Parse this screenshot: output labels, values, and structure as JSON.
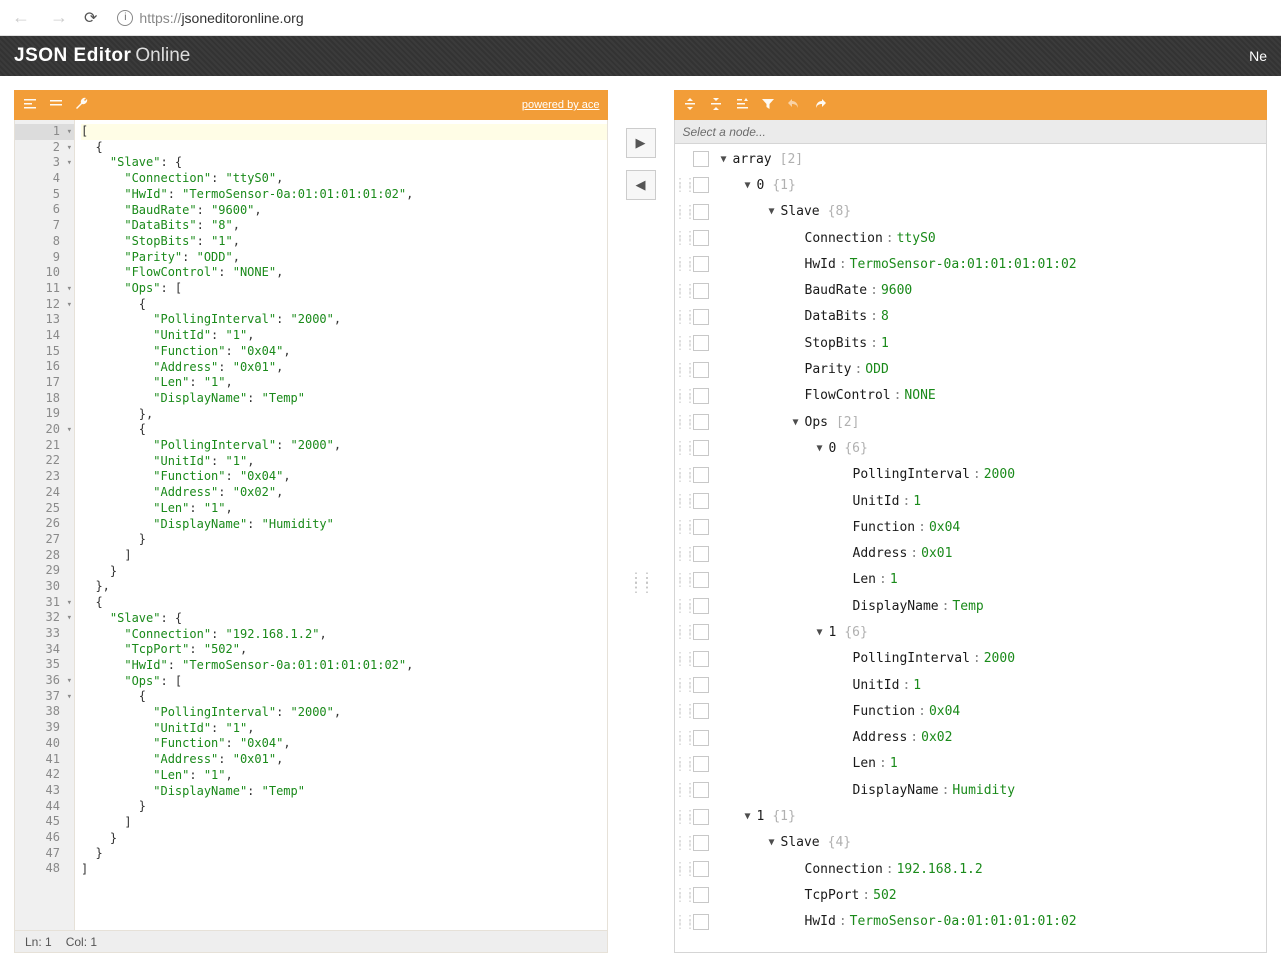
{
  "browser": {
    "url_proto": "https://",
    "url_host": "jsoneditoronline.org"
  },
  "header": {
    "title_strong": "JSON Editor",
    "title_light": "Online",
    "right_cut": "Ne"
  },
  "left_toolbar": {
    "powered": "powered by ace"
  },
  "status": {
    "ln": "Ln: 1",
    "col": "Col: 1"
  },
  "node_path_placeholder": "Select a node...",
  "code_lines": [
    {
      "n": 1,
      "fold": "▾",
      "hl": true,
      "text": "[",
      "parts": [
        {
          "t": "[",
          "c": "pun"
        }
      ]
    },
    {
      "n": 2,
      "fold": "▾",
      "text": "  {",
      "parts": [
        {
          "t": "  {",
          "c": "pun"
        }
      ]
    },
    {
      "n": 3,
      "fold": "▾",
      "parts": [
        {
          "t": "    ",
          "c": "pun"
        },
        {
          "t": "\"Slave\"",
          "c": "str"
        },
        {
          "t": ": {",
          "c": "pun"
        }
      ]
    },
    {
      "n": 4,
      "parts": [
        {
          "t": "      ",
          "c": "pun"
        },
        {
          "t": "\"Connection\"",
          "c": "str"
        },
        {
          "t": ": ",
          "c": "pun"
        },
        {
          "t": "\"ttyS0\"",
          "c": "str"
        },
        {
          "t": ",",
          "c": "pun"
        }
      ]
    },
    {
      "n": 5,
      "parts": [
        {
          "t": "      ",
          "c": "pun"
        },
        {
          "t": "\"HwId\"",
          "c": "str"
        },
        {
          "t": ": ",
          "c": "pun"
        },
        {
          "t": "\"TermoSensor-0a:01:01:01:01:02\"",
          "c": "str"
        },
        {
          "t": ",",
          "c": "pun"
        }
      ]
    },
    {
      "n": 6,
      "parts": [
        {
          "t": "      ",
          "c": "pun"
        },
        {
          "t": "\"BaudRate\"",
          "c": "str"
        },
        {
          "t": ": ",
          "c": "pun"
        },
        {
          "t": "\"9600\"",
          "c": "str"
        },
        {
          "t": ",",
          "c": "pun"
        }
      ]
    },
    {
      "n": 7,
      "parts": [
        {
          "t": "      ",
          "c": "pun"
        },
        {
          "t": "\"DataBits\"",
          "c": "str"
        },
        {
          "t": ": ",
          "c": "pun"
        },
        {
          "t": "\"8\"",
          "c": "str"
        },
        {
          "t": ",",
          "c": "pun"
        }
      ]
    },
    {
      "n": 8,
      "parts": [
        {
          "t": "      ",
          "c": "pun"
        },
        {
          "t": "\"StopBits\"",
          "c": "str"
        },
        {
          "t": ": ",
          "c": "pun"
        },
        {
          "t": "\"1\"",
          "c": "str"
        },
        {
          "t": ",",
          "c": "pun"
        }
      ]
    },
    {
      "n": 9,
      "parts": [
        {
          "t": "      ",
          "c": "pun"
        },
        {
          "t": "\"Parity\"",
          "c": "str"
        },
        {
          "t": ": ",
          "c": "pun"
        },
        {
          "t": "\"ODD\"",
          "c": "str"
        },
        {
          "t": ",",
          "c": "pun"
        }
      ]
    },
    {
      "n": 10,
      "parts": [
        {
          "t": "      ",
          "c": "pun"
        },
        {
          "t": "\"FlowControl\"",
          "c": "str"
        },
        {
          "t": ": ",
          "c": "pun"
        },
        {
          "t": "\"NONE\"",
          "c": "str"
        },
        {
          "t": ",",
          "c": "pun"
        }
      ]
    },
    {
      "n": 11,
      "fold": "▾",
      "parts": [
        {
          "t": "      ",
          "c": "pun"
        },
        {
          "t": "\"Ops\"",
          "c": "str"
        },
        {
          "t": ": [",
          "c": "pun"
        }
      ]
    },
    {
      "n": 12,
      "fold": "▾",
      "parts": [
        {
          "t": "        {",
          "c": "pun"
        }
      ]
    },
    {
      "n": 13,
      "parts": [
        {
          "t": "          ",
          "c": "pun"
        },
        {
          "t": "\"PollingInterval\"",
          "c": "str"
        },
        {
          "t": ": ",
          "c": "pun"
        },
        {
          "t": "\"2000\"",
          "c": "str"
        },
        {
          "t": ",",
          "c": "pun"
        }
      ]
    },
    {
      "n": 14,
      "parts": [
        {
          "t": "          ",
          "c": "pun"
        },
        {
          "t": "\"UnitId\"",
          "c": "str"
        },
        {
          "t": ": ",
          "c": "pun"
        },
        {
          "t": "\"1\"",
          "c": "str"
        },
        {
          "t": ",",
          "c": "pun"
        }
      ]
    },
    {
      "n": 15,
      "parts": [
        {
          "t": "          ",
          "c": "pun"
        },
        {
          "t": "\"Function\"",
          "c": "str"
        },
        {
          "t": ": ",
          "c": "pun"
        },
        {
          "t": "\"0x04\"",
          "c": "str"
        },
        {
          "t": ",",
          "c": "pun"
        }
      ]
    },
    {
      "n": 16,
      "parts": [
        {
          "t": "          ",
          "c": "pun"
        },
        {
          "t": "\"Address\"",
          "c": "str"
        },
        {
          "t": ": ",
          "c": "pun"
        },
        {
          "t": "\"0x01\"",
          "c": "str"
        },
        {
          "t": ",",
          "c": "pun"
        }
      ]
    },
    {
      "n": 17,
      "parts": [
        {
          "t": "          ",
          "c": "pun"
        },
        {
          "t": "\"Len\"",
          "c": "str"
        },
        {
          "t": ": ",
          "c": "pun"
        },
        {
          "t": "\"1\"",
          "c": "str"
        },
        {
          "t": ",",
          "c": "pun"
        }
      ]
    },
    {
      "n": 18,
      "parts": [
        {
          "t": "          ",
          "c": "pun"
        },
        {
          "t": "\"DisplayName\"",
          "c": "str"
        },
        {
          "t": ": ",
          "c": "pun"
        },
        {
          "t": "\"Temp\"",
          "c": "str"
        }
      ]
    },
    {
      "n": 19,
      "parts": [
        {
          "t": "        },",
          "c": "pun"
        }
      ]
    },
    {
      "n": 20,
      "fold": "▾",
      "parts": [
        {
          "t": "        {",
          "c": "pun"
        }
      ]
    },
    {
      "n": 21,
      "parts": [
        {
          "t": "          ",
          "c": "pun"
        },
        {
          "t": "\"PollingInterval\"",
          "c": "str"
        },
        {
          "t": ": ",
          "c": "pun"
        },
        {
          "t": "\"2000\"",
          "c": "str"
        },
        {
          "t": ",",
          "c": "pun"
        }
      ]
    },
    {
      "n": 22,
      "parts": [
        {
          "t": "          ",
          "c": "pun"
        },
        {
          "t": "\"UnitId\"",
          "c": "str"
        },
        {
          "t": ": ",
          "c": "pun"
        },
        {
          "t": "\"1\"",
          "c": "str"
        },
        {
          "t": ",",
          "c": "pun"
        }
      ]
    },
    {
      "n": 23,
      "parts": [
        {
          "t": "          ",
          "c": "pun"
        },
        {
          "t": "\"Function\"",
          "c": "str"
        },
        {
          "t": ": ",
          "c": "pun"
        },
        {
          "t": "\"0x04\"",
          "c": "str"
        },
        {
          "t": ",",
          "c": "pun"
        }
      ]
    },
    {
      "n": 24,
      "parts": [
        {
          "t": "          ",
          "c": "pun"
        },
        {
          "t": "\"Address\"",
          "c": "str"
        },
        {
          "t": ": ",
          "c": "pun"
        },
        {
          "t": "\"0x02\"",
          "c": "str"
        },
        {
          "t": ",",
          "c": "pun"
        }
      ]
    },
    {
      "n": 25,
      "parts": [
        {
          "t": "          ",
          "c": "pun"
        },
        {
          "t": "\"Len\"",
          "c": "str"
        },
        {
          "t": ": ",
          "c": "pun"
        },
        {
          "t": "\"1\"",
          "c": "str"
        },
        {
          "t": ",",
          "c": "pun"
        }
      ]
    },
    {
      "n": 26,
      "parts": [
        {
          "t": "          ",
          "c": "pun"
        },
        {
          "t": "\"DisplayName\"",
          "c": "str"
        },
        {
          "t": ": ",
          "c": "pun"
        },
        {
          "t": "\"Humidity\"",
          "c": "str"
        }
      ]
    },
    {
      "n": 27,
      "parts": [
        {
          "t": "        }",
          "c": "pun"
        }
      ]
    },
    {
      "n": 28,
      "parts": [
        {
          "t": "      ]",
          "c": "pun"
        }
      ]
    },
    {
      "n": 29,
      "parts": [
        {
          "t": "    }",
          "c": "pun"
        }
      ]
    },
    {
      "n": 30,
      "parts": [
        {
          "t": "  },",
          "c": "pun"
        }
      ]
    },
    {
      "n": 31,
      "fold": "▾",
      "parts": [
        {
          "t": "  {",
          "c": "pun"
        }
      ]
    },
    {
      "n": 32,
      "fold": "▾",
      "parts": [
        {
          "t": "    ",
          "c": "pun"
        },
        {
          "t": "\"Slave\"",
          "c": "str"
        },
        {
          "t": ": {",
          "c": "pun"
        }
      ]
    },
    {
      "n": 33,
      "parts": [
        {
          "t": "      ",
          "c": "pun"
        },
        {
          "t": "\"Connection\"",
          "c": "str"
        },
        {
          "t": ": ",
          "c": "pun"
        },
        {
          "t": "\"192.168.1.2\"",
          "c": "str"
        },
        {
          "t": ",",
          "c": "pun"
        }
      ]
    },
    {
      "n": 34,
      "parts": [
        {
          "t": "      ",
          "c": "pun"
        },
        {
          "t": "\"TcpPort\"",
          "c": "str"
        },
        {
          "t": ": ",
          "c": "pun"
        },
        {
          "t": "\"502\"",
          "c": "str"
        },
        {
          "t": ",",
          "c": "pun"
        }
      ]
    },
    {
      "n": 35,
      "parts": [
        {
          "t": "      ",
          "c": "pun"
        },
        {
          "t": "\"HwId\"",
          "c": "str"
        },
        {
          "t": ": ",
          "c": "pun"
        },
        {
          "t": "\"TermoSensor-0a:01:01:01:01:02\"",
          "c": "str"
        },
        {
          "t": ",",
          "c": "pun"
        }
      ]
    },
    {
      "n": 36,
      "fold": "▾",
      "parts": [
        {
          "t": "      ",
          "c": "pun"
        },
        {
          "t": "\"Ops\"",
          "c": "str"
        },
        {
          "t": ": [",
          "c": "pun"
        }
      ]
    },
    {
      "n": 37,
      "fold": "▾",
      "parts": [
        {
          "t": "        {",
          "c": "pun"
        }
      ]
    },
    {
      "n": 38,
      "parts": [
        {
          "t": "          ",
          "c": "pun"
        },
        {
          "t": "\"PollingInterval\"",
          "c": "str"
        },
        {
          "t": ": ",
          "c": "pun"
        },
        {
          "t": "\"2000\"",
          "c": "str"
        },
        {
          "t": ",",
          "c": "pun"
        }
      ]
    },
    {
      "n": 39,
      "parts": [
        {
          "t": "          ",
          "c": "pun"
        },
        {
          "t": "\"UnitId\"",
          "c": "str"
        },
        {
          "t": ": ",
          "c": "pun"
        },
        {
          "t": "\"1\"",
          "c": "str"
        },
        {
          "t": ",",
          "c": "pun"
        }
      ]
    },
    {
      "n": 40,
      "parts": [
        {
          "t": "          ",
          "c": "pun"
        },
        {
          "t": "\"Function\"",
          "c": "str"
        },
        {
          "t": ": ",
          "c": "pun"
        },
        {
          "t": "\"0x04\"",
          "c": "str"
        },
        {
          "t": ",",
          "c": "pun"
        }
      ]
    },
    {
      "n": 41,
      "parts": [
        {
          "t": "          ",
          "c": "pun"
        },
        {
          "t": "\"Address\"",
          "c": "str"
        },
        {
          "t": ": ",
          "c": "pun"
        },
        {
          "t": "\"0x01\"",
          "c": "str"
        },
        {
          "t": ",",
          "c": "pun"
        }
      ]
    },
    {
      "n": 42,
      "parts": [
        {
          "t": "          ",
          "c": "pun"
        },
        {
          "t": "\"Len\"",
          "c": "str"
        },
        {
          "t": ": ",
          "c": "pun"
        },
        {
          "t": "\"1\"",
          "c": "str"
        },
        {
          "t": ",",
          "c": "pun"
        }
      ]
    },
    {
      "n": 43,
      "parts": [
        {
          "t": "          ",
          "c": "pun"
        },
        {
          "t": "\"DisplayName\"",
          "c": "str"
        },
        {
          "t": ": ",
          "c": "pun"
        },
        {
          "t": "\"Temp\"",
          "c": "str"
        }
      ]
    },
    {
      "n": 44,
      "parts": [
        {
          "t": "        }",
          "c": "pun"
        }
      ]
    },
    {
      "n": 45,
      "parts": [
        {
          "t": "      ]",
          "c": "pun"
        }
      ]
    },
    {
      "n": 46,
      "parts": [
        {
          "t": "    }",
          "c": "pun"
        }
      ]
    },
    {
      "n": 47,
      "parts": [
        {
          "t": "  }",
          "c": "pun"
        }
      ]
    },
    {
      "n": 48,
      "parts": [
        {
          "t": "]",
          "c": "pun"
        }
      ]
    }
  ],
  "tree_rows": [
    {
      "drag": false,
      "indent": 0,
      "expand": "▼",
      "key": "array",
      "meta": "[2]"
    },
    {
      "drag": true,
      "indent": 1,
      "expand": "▼",
      "key": "0",
      "meta": "{1}"
    },
    {
      "drag": true,
      "indent": 2,
      "expand": "▼",
      "key": "Slave",
      "meta": "{8}"
    },
    {
      "drag": true,
      "indent": 3,
      "expand": "",
      "key": "Connection",
      "sep": ":",
      "val": "ttyS0"
    },
    {
      "drag": true,
      "indent": 3,
      "expand": "",
      "key": "HwId",
      "sep": ":",
      "val": "TermoSensor-0a:01:01:01:01:02"
    },
    {
      "drag": true,
      "indent": 3,
      "expand": "",
      "key": "BaudRate",
      "sep": ":",
      "val": "9600"
    },
    {
      "drag": true,
      "indent": 3,
      "expand": "",
      "key": "DataBits",
      "sep": ":",
      "val": "8"
    },
    {
      "drag": true,
      "indent": 3,
      "expand": "",
      "key": "StopBits",
      "sep": ":",
      "val": "1"
    },
    {
      "drag": true,
      "indent": 3,
      "expand": "",
      "key": "Parity",
      "sep": ":",
      "val": "ODD"
    },
    {
      "drag": true,
      "indent": 3,
      "expand": "",
      "key": "FlowControl",
      "sep": ":",
      "val": "NONE"
    },
    {
      "drag": true,
      "indent": 3,
      "expand": "▼",
      "key": "Ops",
      "meta": "[2]"
    },
    {
      "drag": true,
      "indent": 4,
      "expand": "▼",
      "key": "0",
      "meta": "{6}"
    },
    {
      "drag": true,
      "indent": 5,
      "expand": "",
      "key": "PollingInterval",
      "sep": ":",
      "val": "2000"
    },
    {
      "drag": true,
      "indent": 5,
      "expand": "",
      "key": "UnitId",
      "sep": ":",
      "val": "1"
    },
    {
      "drag": true,
      "indent": 5,
      "expand": "",
      "key": "Function",
      "sep": ":",
      "val": "0x04"
    },
    {
      "drag": true,
      "indent": 5,
      "expand": "",
      "key": "Address",
      "sep": ":",
      "val": "0x01"
    },
    {
      "drag": true,
      "indent": 5,
      "expand": "",
      "key": "Len",
      "sep": " :",
      "val": "1"
    },
    {
      "drag": true,
      "indent": 5,
      "expand": "",
      "key": "DisplayName",
      "sep": ":",
      "val": "Temp"
    },
    {
      "drag": true,
      "indent": 4,
      "expand": "▼",
      "key": "1",
      "meta": "{6}"
    },
    {
      "drag": true,
      "indent": 5,
      "expand": "",
      "key": "PollingInterval",
      "sep": ":",
      "val": "2000"
    },
    {
      "drag": true,
      "indent": 5,
      "expand": "",
      "key": "UnitId",
      "sep": ":",
      "val": "1"
    },
    {
      "drag": true,
      "indent": 5,
      "expand": "",
      "key": "Function",
      "sep": ":",
      "val": "0x04"
    },
    {
      "drag": true,
      "indent": 5,
      "expand": "",
      "key": "Address",
      "sep": ":",
      "val": "0x02"
    },
    {
      "drag": true,
      "indent": 5,
      "expand": "",
      "key": "Len",
      "sep": " :",
      "val": "1"
    },
    {
      "drag": true,
      "indent": 5,
      "expand": "",
      "key": "DisplayName",
      "sep": ":",
      "val": "Humidity"
    },
    {
      "drag": true,
      "indent": 1,
      "expand": "▼",
      "key": "1",
      "meta": "{1}"
    },
    {
      "drag": true,
      "indent": 2,
      "expand": "▼",
      "key": "Slave",
      "meta": "{4}"
    },
    {
      "drag": true,
      "indent": 3,
      "expand": "",
      "key": "Connection",
      "sep": ":",
      "val": "192.168.1.2"
    },
    {
      "drag": true,
      "indent": 3,
      "expand": "",
      "key": "TcpPort",
      "sep": ":",
      "val": "502"
    },
    {
      "drag": true,
      "indent": 3,
      "expand": "",
      "key": "HwId",
      "sep": ":",
      "val": "TermoSensor-0a:01:01:01:01:02"
    }
  ]
}
